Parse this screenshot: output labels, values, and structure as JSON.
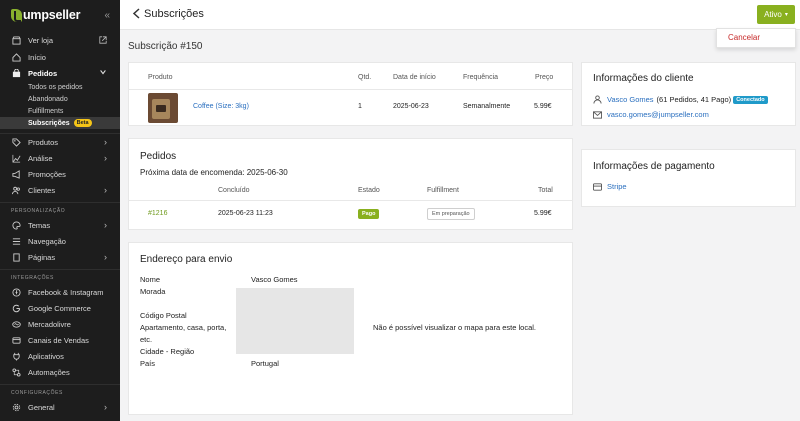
{
  "sidebar": {
    "logo": "umpseller",
    "collapse": "«",
    "items": [
      {
        "label": "Ver loja"
      },
      {
        "label": "Início"
      },
      {
        "label": "Pedidos"
      },
      {
        "label": "Todos os pedidos"
      },
      {
        "label": "Abandonado"
      },
      {
        "label": "Fulfillments"
      },
      {
        "label": "Subscrições",
        "badge": "Beta"
      },
      {
        "label": "Produtos"
      },
      {
        "label": "Análise"
      },
      {
        "label": "Promoções"
      },
      {
        "label": "Clientes"
      }
    ],
    "section_personalizacao": "PERSONALIZAÇÃO",
    "personalizacao": [
      {
        "label": "Temas"
      },
      {
        "label": "Navegação"
      },
      {
        "label": "Páginas"
      }
    ],
    "section_integracoes": "INTEGRAÇÕES",
    "integracoes": [
      {
        "label": "Facebook & Instagram"
      },
      {
        "label": "Google Commerce"
      },
      {
        "label": "Mercadolivre"
      },
      {
        "label": "Canais de Vendas"
      },
      {
        "label": "Aplicativos"
      },
      {
        "label": "Automações"
      }
    ],
    "section_configuracoes": "CONFIGURAÇÕES",
    "configuracoes": [
      {
        "label": "General"
      }
    ]
  },
  "header": {
    "title": "Subscrições",
    "status_button": "Ativo",
    "dropdown_item": "Cancelar"
  },
  "page_title": "Subscrição #150",
  "products": {
    "columns": [
      "Produto",
      "Qtd.",
      "Data de início",
      "Frequência",
      "Preço"
    ],
    "rows": [
      {
        "name": "Coffee (Size: 3kg)",
        "qty": "1",
        "start": "2025-06-23",
        "frequency": "Semanalmente",
        "price": "5.99€"
      }
    ]
  },
  "orders": {
    "title": "Pedidos",
    "next_date": "Próxima data de encomenda: 2025-06-30",
    "columns": [
      "Concluído",
      "Estado",
      "Fulfillment",
      "Total"
    ],
    "rows": [
      {
        "id": "#1216",
        "completed": "2025-06-23 11:23",
        "status": "Pago",
        "fulfillment": "Em preparação",
        "total": "5.99€"
      }
    ]
  },
  "shipping": {
    "title": "Endereço para envio",
    "labels": [
      "Nome",
      "Morada",
      "Código Postal",
      "Apartamento, casa, porta,",
      "etc.",
      "Cidade - Região",
      "País"
    ],
    "name": "Vasco Gomes",
    "country": "Portugal",
    "map_message": "Não é possível visualizar o mapa para este local."
  },
  "customer": {
    "title": "Informações do cliente",
    "name": "Vasco Gomes",
    "orders_summary": "(61 Pedidos, 41 Pago)",
    "badge": "Conectado",
    "email": "vasco.gomes@jumpseller.com"
  },
  "payment": {
    "title": "Informações de pagamento",
    "method": "Stripe"
  },
  "colors": {
    "accent": "#89b01f",
    "link": "#2a6fbf",
    "danger": "#c62828",
    "sidebar_bg": "#1d1d1d"
  }
}
